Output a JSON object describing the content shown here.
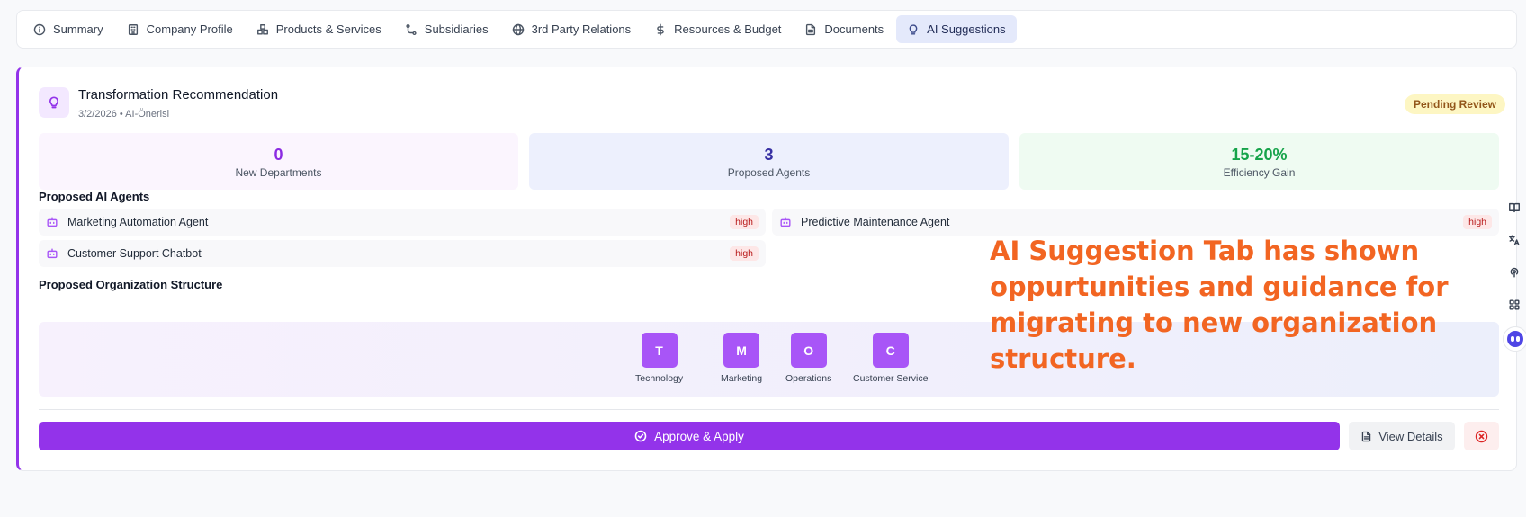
{
  "tabs": [
    {
      "label": "Summary",
      "icon": "info-icon"
    },
    {
      "label": "Company Profile",
      "icon": "building-icon"
    },
    {
      "label": "Products & Services",
      "icon": "boxes-icon"
    },
    {
      "label": "Subsidiaries",
      "icon": "branch-icon"
    },
    {
      "label": "3rd Party Relations",
      "icon": "globe-icon"
    },
    {
      "label": "Resources & Budget",
      "icon": "dollar-icon"
    },
    {
      "label": "Documents",
      "icon": "document-icon"
    },
    {
      "label": "AI Suggestions",
      "icon": "lightbulb-icon",
      "active": true
    }
  ],
  "recommendation": {
    "title": "Transformation Recommendation",
    "meta": "3/2/2026 • AI-Önerisi",
    "status": "Pending Review",
    "stats": [
      {
        "value": "0",
        "label": "New Departments"
      },
      {
        "value": "3",
        "label": "Proposed Agents"
      },
      {
        "value": "15-20%",
        "label": "Efficiency Gain"
      }
    ],
    "agents_heading": "Proposed AI Agents",
    "agents": [
      {
        "name": "Marketing Automation Agent",
        "priority": "high"
      },
      {
        "name": "Predictive Maintenance Agent",
        "priority": "high"
      },
      {
        "name": "Customer Support Chatbot",
        "priority": "high"
      }
    ],
    "org_heading": "Proposed Organization Structure",
    "org_units": [
      {
        "initial": "T",
        "name": "Technology"
      },
      {
        "initial": "M",
        "name": "Marketing"
      },
      {
        "initial": "O",
        "name": "Operations"
      },
      {
        "initial": "C",
        "name": "Customer Service"
      }
    ],
    "actions": {
      "approve": "Approve & Apply",
      "view": "View Details"
    }
  },
  "annotation": "AI Suggestion Tab has shown oppurtunities and guidance for migrating to new organization structure.",
  "colors": {
    "accent": "#9333ea",
    "annotation": "#f26522",
    "badge_bg": "#fdf6c3"
  }
}
